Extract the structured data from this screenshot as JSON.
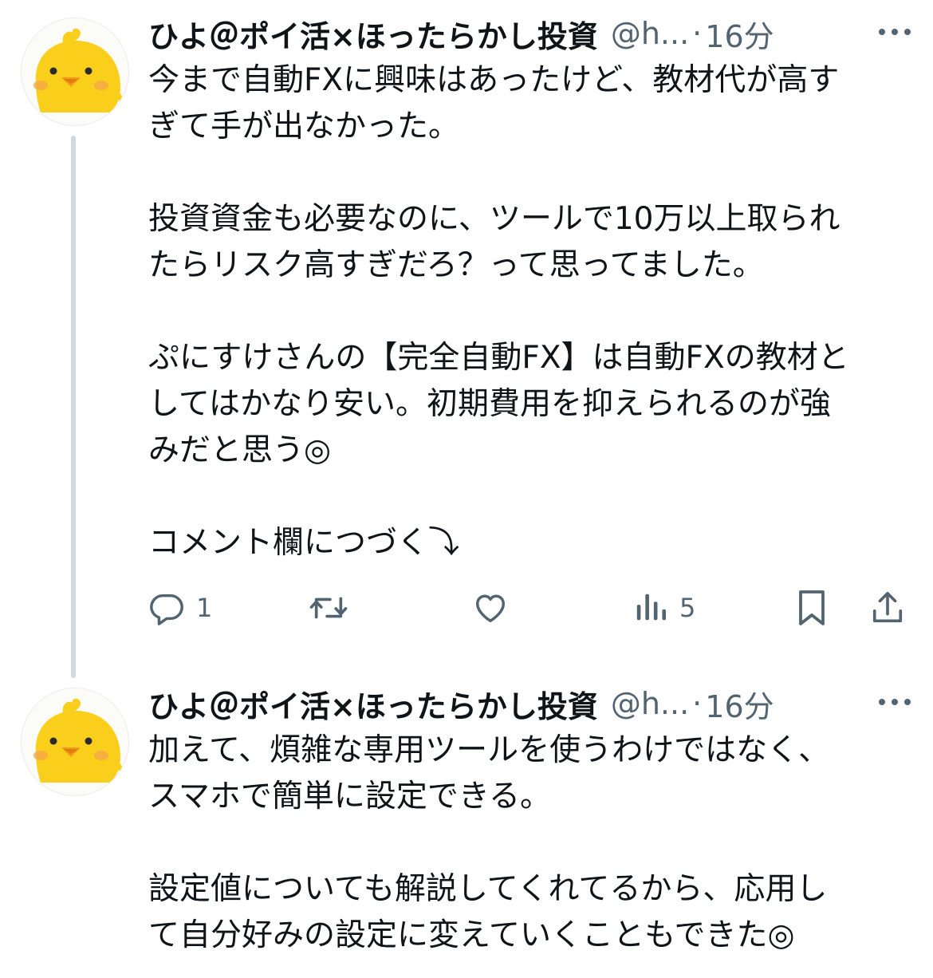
{
  "tweets": [
    {
      "author": {
        "name": "ひよ＠ポイ活×ほったらかし投資",
        "handle": "@h...",
        "separator": "·",
        "time": "16分"
      },
      "paragraphs": [
        "今まで自動FXに興味はあったけど、教材代が高す\nぎて手が出なかった。",
        "投資資金も必要なのに、ツールで10万以上取られ\nたらリスク高すぎだろ？って思ってました。",
        "ぷにすけさんの【完全自動FX】は自動FXの教材と\nしてはかなり安い。初期費用を抑えられるのが強\nみだと思う◎",
        "コメント欄につづく⤵"
      ],
      "actions": {
        "reply_count": "1",
        "views_count": "5"
      }
    },
    {
      "author": {
        "name": "ひよ＠ポイ活×ほったらかし投資",
        "handle": "@h...",
        "separator": "·",
        "time": "16分"
      },
      "paragraphs": [
        "加えて、煩雑な専用ツールを使うわけではなく、\nスマホで簡単に設定できる。",
        "設定値についても解説してくれてるから、応用し\nて自分好みの設定に変えていくこともできた◎"
      ]
    }
  ],
  "colors": {
    "text": "#0f1419",
    "muted": "#536471",
    "thread_line": "#cfd9de",
    "avatar_chick": "#f9cf1c",
    "avatar_beak": "#f39a1c",
    "avatar_cheek": "#f6a64a"
  },
  "icons": {
    "avatar": "yellow-chick",
    "more": "more-dots-icon",
    "reply": "reply-icon",
    "retweet": "retweet-icon",
    "like": "heart-icon",
    "views": "views-bars-icon",
    "bookmark": "bookmark-icon",
    "share": "share-icon"
  }
}
